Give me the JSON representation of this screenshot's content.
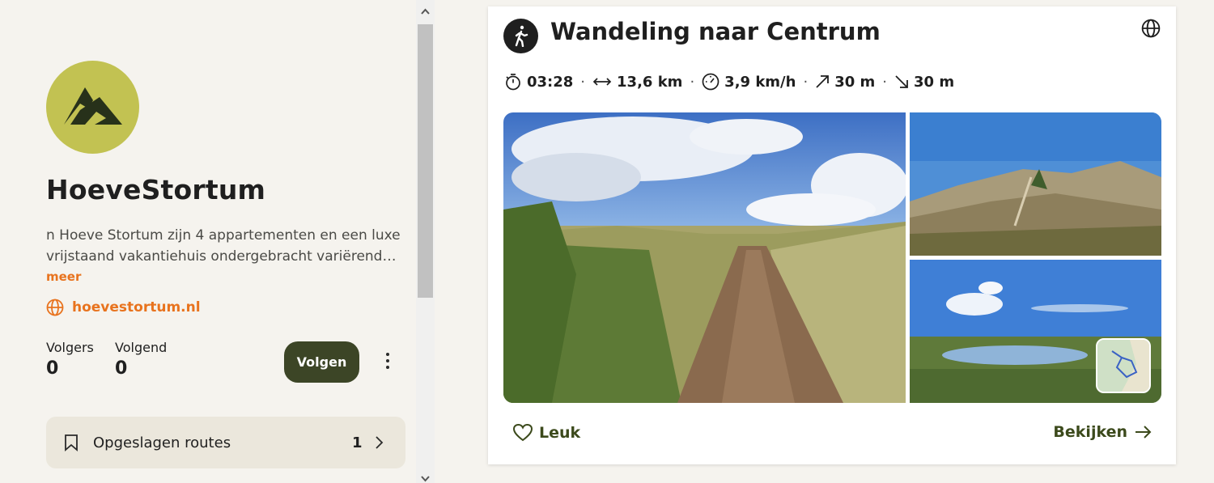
{
  "profile": {
    "name": "HoeveStortum",
    "description": "n Hoeve Stortum zijn 4 appartementen en een luxe vrijstaand vakantiehuis ondergebracht variërend…",
    "more_label": "meer",
    "website": "hoevestortum.nl",
    "followers_label": "Volgers",
    "followers_count": "0",
    "following_label": "Volgend",
    "following_count": "0",
    "follow_button": "Volgen",
    "saved_routes_label": "Opgeslagen routes",
    "saved_routes_count": "1",
    "avatar_color": "#c2c252"
  },
  "route": {
    "title": "Wandeling naar Centrum",
    "activity_icon": "hiking-icon",
    "stats": {
      "duration": "03:28",
      "distance": "13,6 km",
      "speed": "3,9 km/h",
      "ascent": "30 m",
      "descent": "30 m"
    },
    "like_label": "Leuk",
    "view_label": "Bekijken"
  },
  "colors": {
    "accent_orange": "#e8731e",
    "button_dark_green": "#3c4526",
    "action_green": "#3c4a1c"
  }
}
